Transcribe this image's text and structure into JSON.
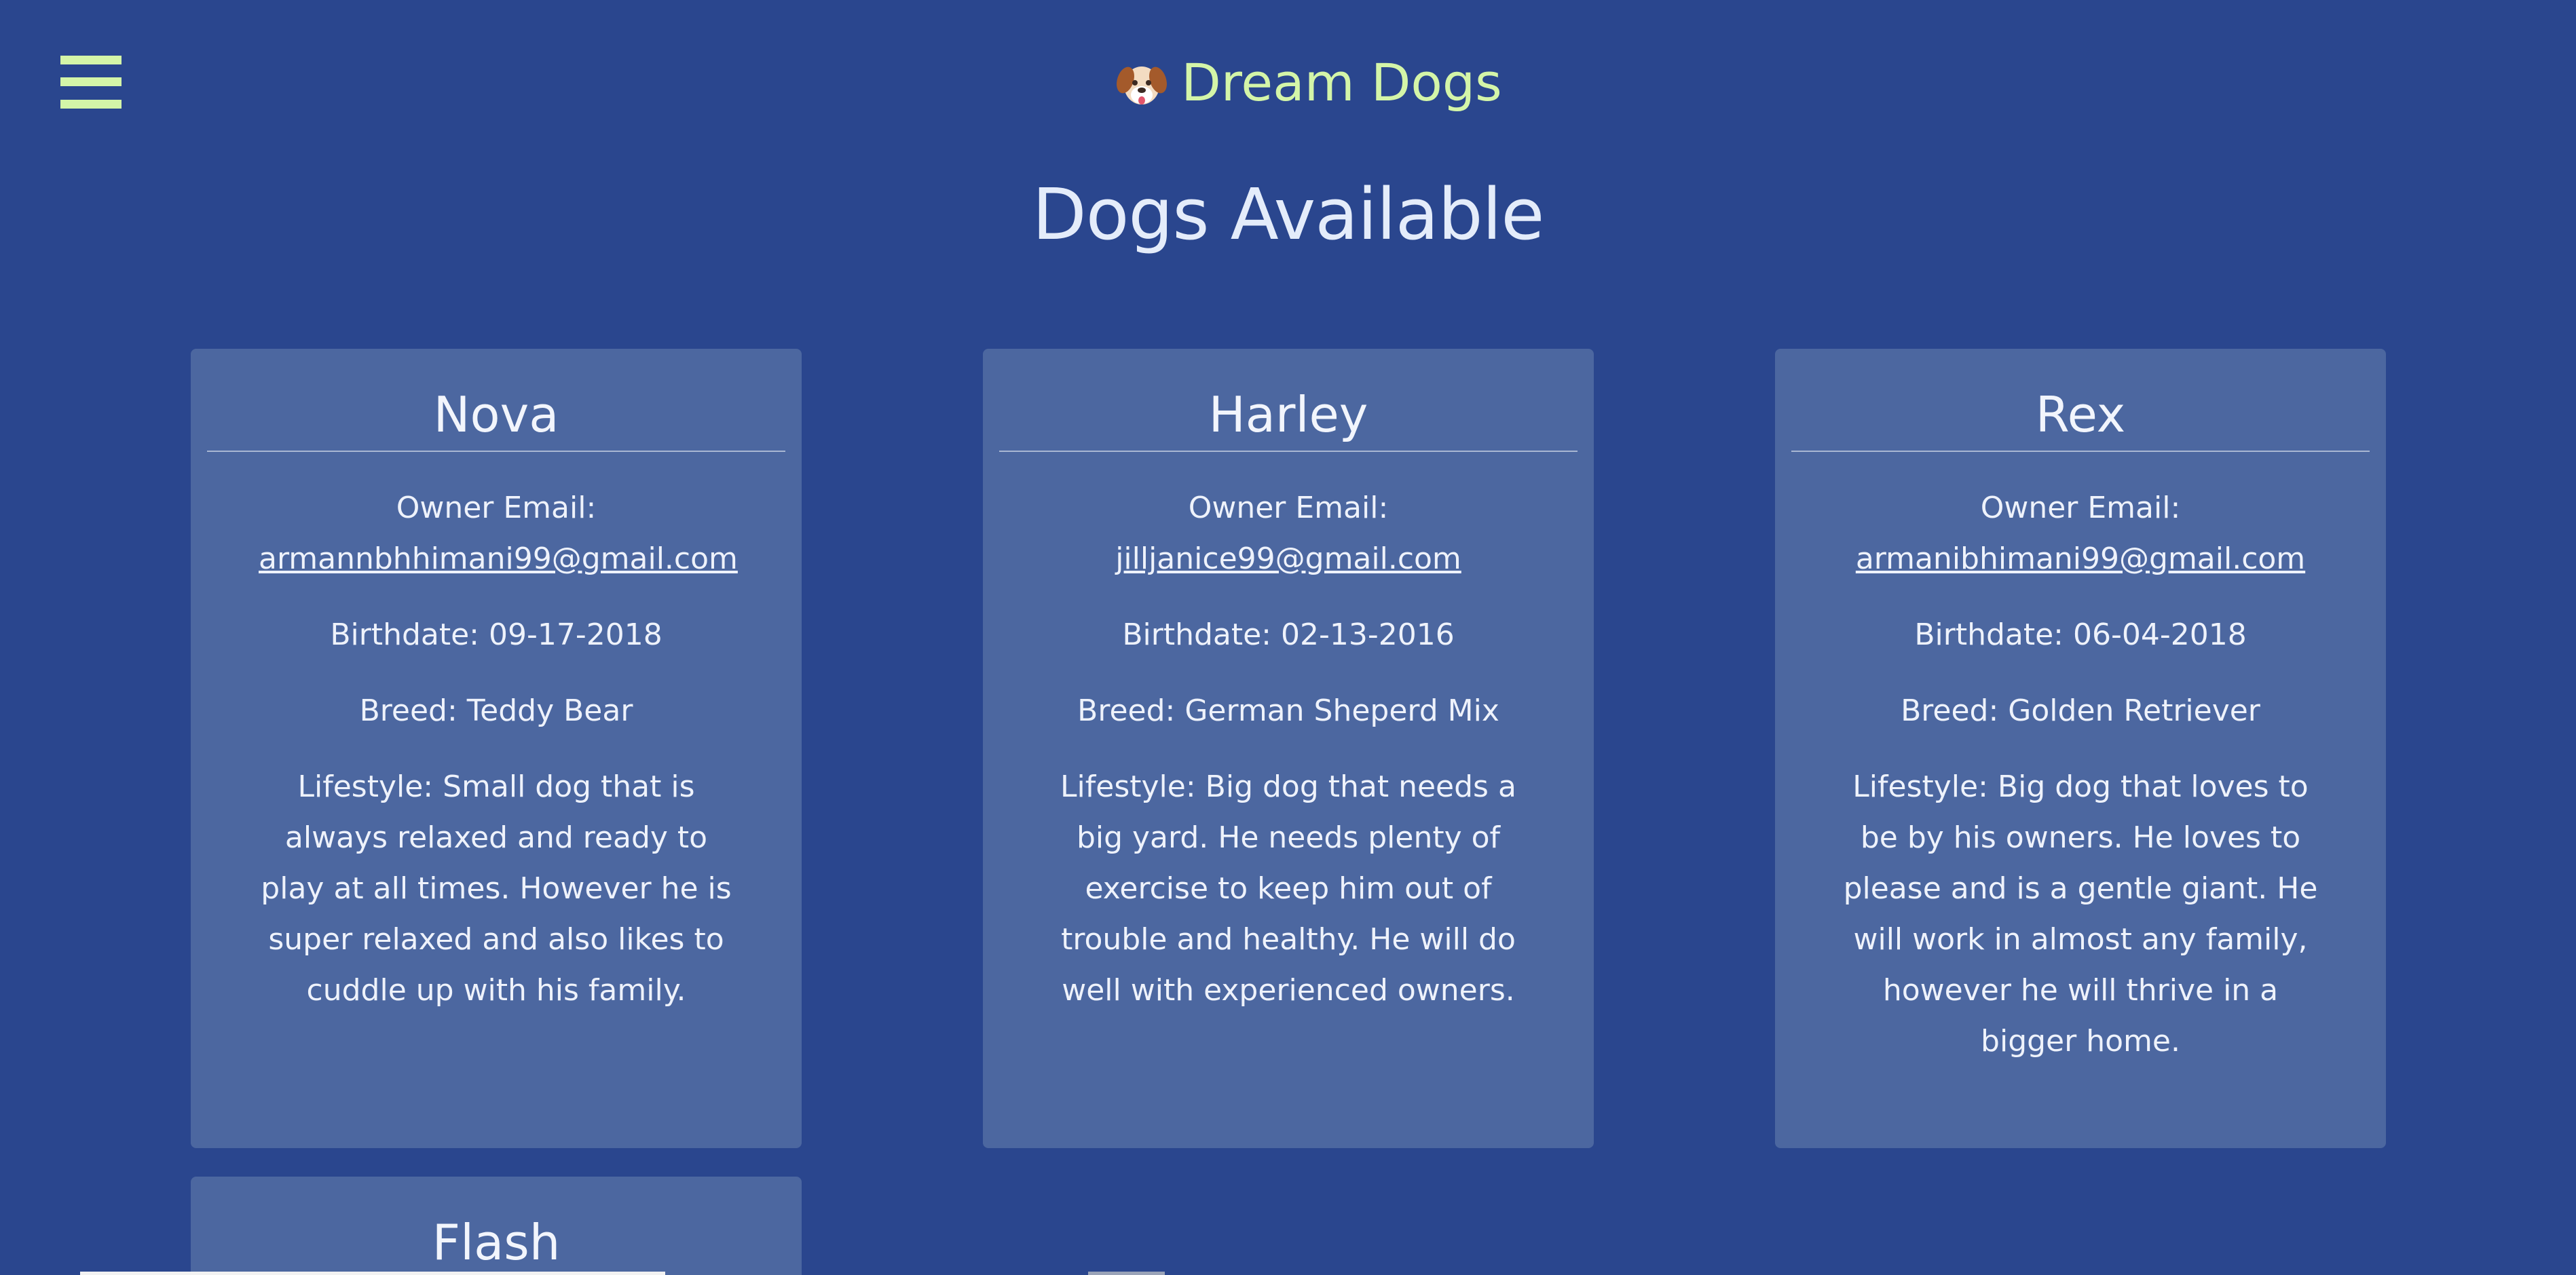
{
  "header": {
    "menu_icon": "hamburger-menu-icon",
    "brand_icon": "dog-face-icon",
    "brand_title": "Dream Dogs",
    "accent_color": "#d4f5a8"
  },
  "page_title": "Dogs Available",
  "dogs": [
    {
      "name": "Nova",
      "owner_email_label": "Owner Email:",
      "owner_email": "armannbhhimani99@gmail.com",
      "birthdate": "Birthdate: 09-17-2018",
      "breed": "Breed: Teddy Bear",
      "lifestyle": "Lifestyle: Small dog that is always relaxed and ready to play at all times. However he is super relaxed and also likes to cuddle up with his family."
    },
    {
      "name": "Harley",
      "owner_email_label": "Owner Email:",
      "owner_email": "jilljanice99@gmail.com",
      "birthdate": "Birthdate: 02-13-2016",
      "breed": "Breed: German Sheperd Mix",
      "lifestyle": "Lifestyle: Big dog that needs a big yard. He needs plenty of exercise to keep him out of trouble and healthy. He will do well with experienced owners."
    },
    {
      "name": "Rex",
      "owner_email_label": "Owner Email:",
      "owner_email": "armanibhimani99@gmail.com",
      "birthdate": "Birthdate: 06-04-2018",
      "breed": "Breed: Golden Retriever",
      "lifestyle": "Lifestyle: Big dog that loves to be by his owners. He loves to please and is a gentle giant. He will work in almost any family, however he will thrive in a bigger home."
    },
    {
      "name": "Flash"
    }
  ],
  "colors": {
    "background": "#2a468e",
    "card": "#4c67a0",
    "text": "#eef2fb"
  }
}
